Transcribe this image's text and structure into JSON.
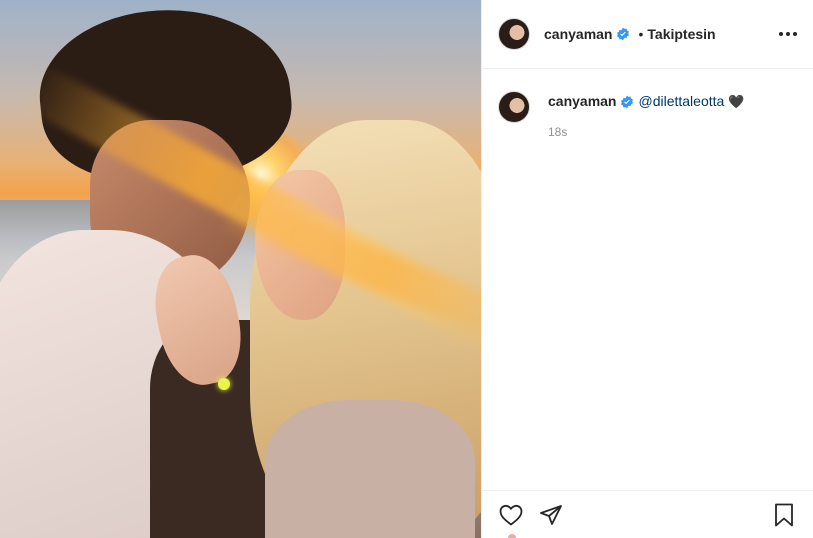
{
  "post": {
    "image_alt": "photo",
    "author": {
      "username": "canyaman",
      "verified": true,
      "follow_status": "Takiptesin",
      "separator": "•"
    },
    "caption": {
      "username": "canyaman",
      "mention": "@dilettaleotta",
      "emoji": "🖤",
      "time": "18s"
    },
    "icons": {
      "more": "more-options-icon",
      "like": "heart-icon",
      "share": "share-icon",
      "save": "bookmark-icon"
    },
    "colors": {
      "text": "#262626",
      "mention": "#00376b",
      "muted": "#8e8e8e",
      "verified": "#3897f0"
    }
  }
}
